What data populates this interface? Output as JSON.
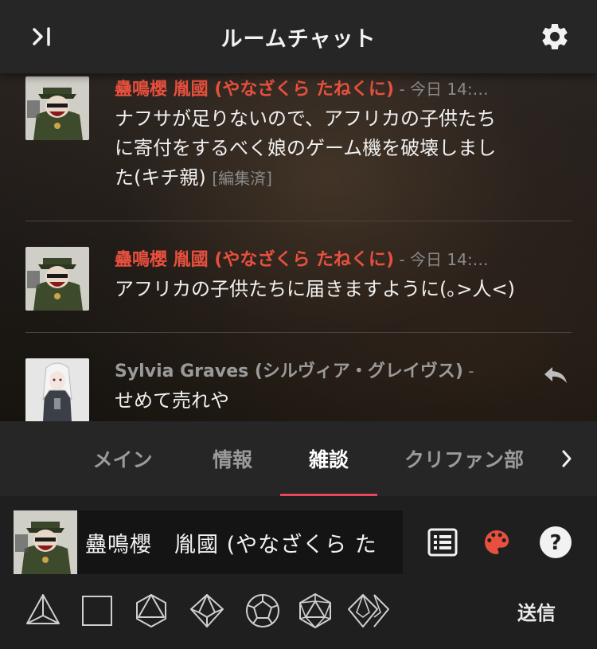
{
  "header": {
    "title": "ルームチャット",
    "collapse_icon": "collapse-right-icon",
    "settings_icon": "gear-icon"
  },
  "messages": [
    {
      "sender": "蠱鳴櫻 胤國 (やなざくら たねくに)",
      "separator": " - ",
      "timestamp": "今日 14:…",
      "lines": [
        "ナフサが足りないので、アフリカの子供たち",
        "に寄付をするべく娘のゲーム機を破壊しまし",
        "た(キチ親)"
      ],
      "edited": "[編集済]",
      "sender_color": "#e8503e"
    },
    {
      "sender": "蠱鳴櫻 胤國 (やなざくら たねくに)",
      "separator": " - ",
      "timestamp": "今日 14:…",
      "lines": [
        "アフリカの子供たちに届きますように(｡>人<)"
      ],
      "sender_color": "#e8503e"
    },
    {
      "sender": "Sylvia Graves (シルヴィア・グレイヴス)",
      "separator": " - ",
      "lines": [
        "せめて売れや"
      ],
      "sender_color": "#9a9a9a",
      "reply_icon": "reply-icon"
    }
  ],
  "tabs": [
    {
      "label": "メイン",
      "active": false
    },
    {
      "label": "情報",
      "active": false
    },
    {
      "label": "雑談",
      "active": true
    },
    {
      "label": "クリファン部",
      "active": false
    }
  ],
  "tabs_next_icon": "chevron-right-icon",
  "input": {
    "character_name": "蠱鳴櫻　胤國 (やなざくら た",
    "list_icon": "list-icon",
    "palette_icon": "palette-icon",
    "help_icon": "help-icon",
    "palette_color": "#e8503e"
  },
  "dice": [
    "d4-icon",
    "d6-icon",
    "d8-icon",
    "d10-icon",
    "d12-icon",
    "d20-icon",
    "d100-icon"
  ],
  "send_label": "送信",
  "colors": {
    "accent": "#e8455f",
    "sender_red": "#e8503e"
  }
}
